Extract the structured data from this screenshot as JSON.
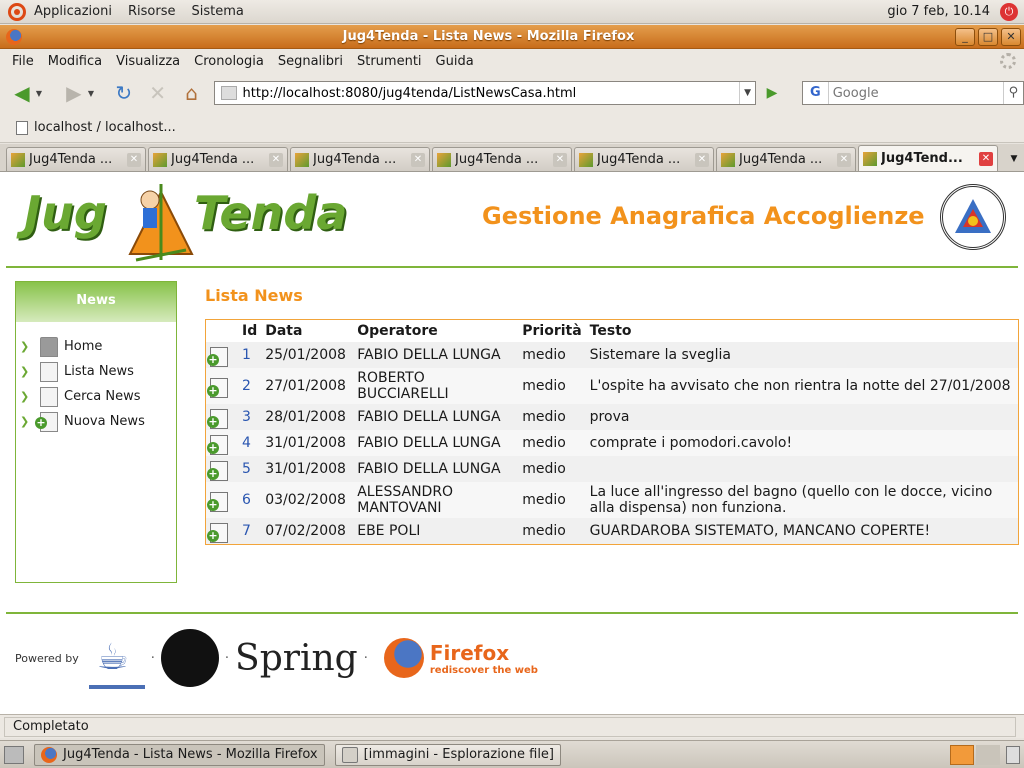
{
  "top_panel": {
    "menus": [
      "Applicazioni",
      "Risorse",
      "Sistema"
    ],
    "clock": "gio  7 feb, 10.14"
  },
  "window": {
    "title": "Jug4Tenda - Lista News - Mozilla Firefox"
  },
  "menu_bar": {
    "items": [
      "File",
      "Modifica",
      "Visualizza",
      "Cronologia",
      "Segnalibri",
      "Strumenti",
      "Guida"
    ]
  },
  "nav": {
    "url": "http://localhost:8080/jug4tenda/ListNewsCasa.html",
    "search_placeholder": "Google",
    "search_engine_letter": "G"
  },
  "bookmarks": {
    "item": "localhost / localhost..."
  },
  "tabs": [
    {
      "label": "Jug4Tenda ...",
      "active": false
    },
    {
      "label": "Jug4Tenda ...",
      "active": false
    },
    {
      "label": "Jug4Tenda ...",
      "active": false
    },
    {
      "label": "Jug4Tenda ...",
      "active": false
    },
    {
      "label": "Jug4Tenda ...",
      "active": false
    },
    {
      "label": "Jug4Tenda ...",
      "active": false
    },
    {
      "label": "Jug4Tend...",
      "active": true
    }
  ],
  "page": {
    "logo_left": "Jug",
    "logo_right": "Tenda",
    "app_title": "Gestione Anagrafica Accoglienze",
    "sidebar": {
      "heading": "News",
      "items": [
        {
          "label": "Home",
          "icon": "home-icon"
        },
        {
          "label": "Lista News",
          "icon": "list-icon"
        },
        {
          "label": "Cerca News",
          "icon": "search-document-icon"
        },
        {
          "label": "Nuova News",
          "icon": "add-document-icon"
        }
      ]
    },
    "list_title": "Lista News",
    "table": {
      "headers": [
        "Id",
        "Data",
        "Operatore",
        "Priorità",
        "Testo"
      ],
      "rows": [
        {
          "id": "1",
          "data": "25/01/2008",
          "operatore": "FABIO DELLA LUNGA",
          "priorita": "medio",
          "testo": "Sistemare la sveglia"
        },
        {
          "id": "2",
          "data": "27/01/2008",
          "operatore": "ROBERTO BUCCIARELLI",
          "priorita": "medio",
          "testo": "L'ospite ha avvisato che non rientra la notte del 27/01/2008"
        },
        {
          "id": "3",
          "data": "28/01/2008",
          "operatore": "FABIO DELLA LUNGA",
          "priorita": "medio",
          "testo": "prova"
        },
        {
          "id": "4",
          "data": "31/01/2008",
          "operatore": "FABIO DELLA LUNGA",
          "priorita": "medio",
          "testo": "comprate i pomodori.cavolo!"
        },
        {
          "id": "5",
          "data": "31/01/2008",
          "operatore": "FABIO DELLA LUNGA",
          "priorita": "medio",
          "testo": ""
        },
        {
          "id": "6",
          "data": "03/02/2008",
          "operatore": "ALESSANDRO MANTOVANI",
          "priorita": "medio",
          "testo": "La luce all'ingresso del bagno (quello con le docce, vicino alla dispensa) non funziona."
        },
        {
          "id": "7",
          "data": "07/02/2008",
          "operatore": "EBE POLI",
          "priorita": "medio",
          "testo": "GUARDAROBA SISTEMATO, MANCANO COPERTE!"
        }
      ]
    },
    "footer": {
      "powered_by": "Powered by",
      "spring": "Spring",
      "firefox_name": "Firefox",
      "firefox_tagline": "rediscover the web",
      "separator": "·"
    }
  },
  "status": {
    "text": "Completato"
  },
  "taskbar": {
    "tasks": [
      {
        "label": "Jug4Tenda - Lista News - Mozilla Firefox",
        "active": true
      },
      {
        "label": "[immagini - Esplorazione file]",
        "active": false
      }
    ]
  },
  "colors": {
    "accent_orange": "#f2921c",
    "accent_green": "#7fb53a",
    "link_blue": "#2a56b0"
  }
}
